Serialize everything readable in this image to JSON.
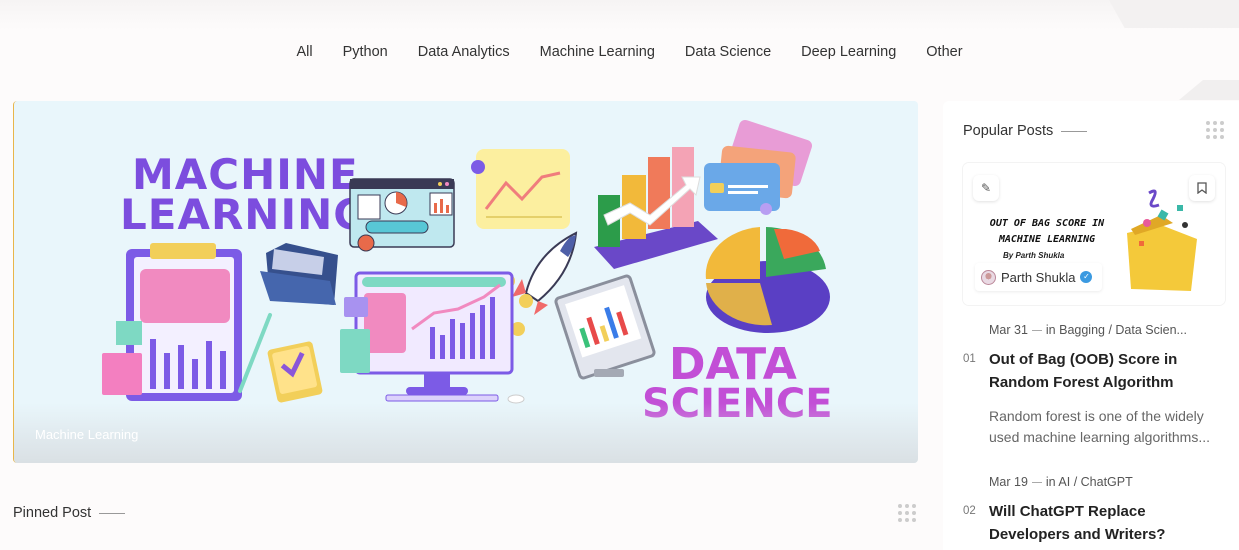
{
  "nav": {
    "items": [
      "All",
      "Python",
      "Data Analytics",
      "Machine Learning",
      "Data Science",
      "Deep Learning",
      "Other"
    ]
  },
  "hero": {
    "category": "Machine Learning",
    "art_text_1": "MACHINE",
    "art_text_2": "LEARNING",
    "art_text_3": "DATA",
    "art_text_4": "SCIENCE"
  },
  "pinned": {
    "heading": "Pinned Post"
  },
  "sidebar": {
    "heading": "Popular Posts",
    "featured": {
      "image_title": "OUT OF BAG SCORE IN MACHINE LEARNING",
      "image_byline": "By Parth Shukla",
      "author": "Parth Shukla",
      "edit_icon": "pencil-icon",
      "bookmark_icon": "bookmark-icon"
    },
    "posts": [
      {
        "num": "01",
        "date": "Mar 31",
        "category": "in Bagging / Data Scien...",
        "title": "Out of Bag (OOB) Score in Random Forest Algorithm",
        "excerpt": "Random forest is one of the widely used machine learning algorithms..."
      },
      {
        "num": "02",
        "date": "Mar 19",
        "category": "in AI / ChatGPT",
        "title": "Will ChatGPT Replace Developers and Writers?",
        "excerpt": ""
      }
    ]
  },
  "colors": {
    "accent": "#e8b64a",
    "hero_bg": "#e9f6fb",
    "art_purple": "#7c4dde",
    "art_magenta": "#c24fd6"
  }
}
